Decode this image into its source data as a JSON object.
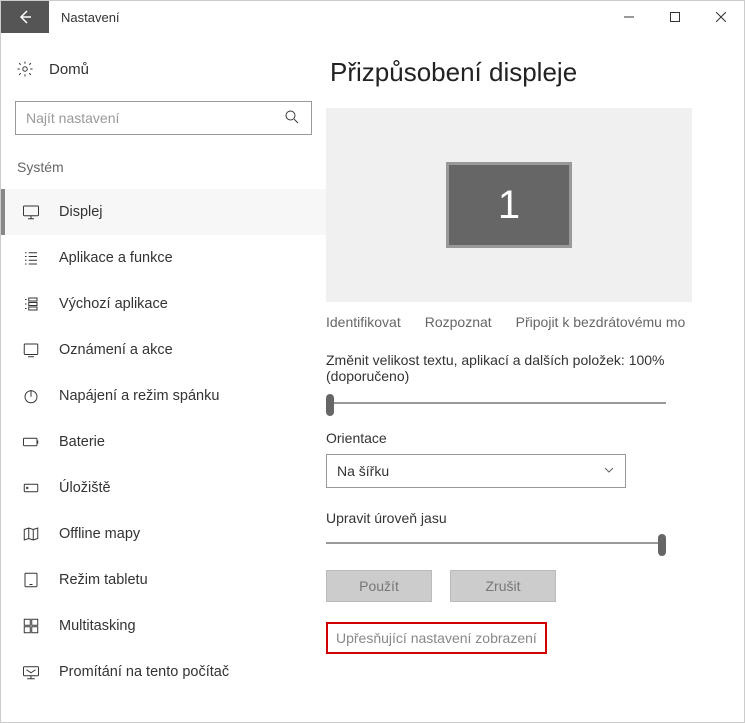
{
  "window": {
    "title": "Nastavení"
  },
  "home": {
    "label": "Domů"
  },
  "search": {
    "placeholder": "Najít nastavení"
  },
  "category": {
    "label": "Systém"
  },
  "nav": {
    "items": [
      {
        "label": "Displej"
      },
      {
        "label": "Aplikace a funkce"
      },
      {
        "label": "Výchozí aplikace"
      },
      {
        "label": "Oznámení a akce"
      },
      {
        "label": "Napájení a režim spánku"
      },
      {
        "label": "Baterie"
      },
      {
        "label": "Úložiště"
      },
      {
        "label": "Offline mapy"
      },
      {
        "label": "Režim tabletu"
      },
      {
        "label": "Multitasking"
      },
      {
        "label": "Promítání na tento počítač"
      }
    ]
  },
  "main": {
    "title": "Přizpůsobení displeje",
    "display_number": "1",
    "links": {
      "identify": "Identifikovat",
      "detect": "Rozpoznat",
      "wireless": "Připojit k bezdrátovému mo"
    },
    "scale_label": "Změnit velikost textu, aplikací a dalších položek: 100% (doporučeno)",
    "orientation_label": "Orientace",
    "orientation_value": "Na šířku",
    "brightness_label": "Upravit úroveň jasu",
    "apply": "Použít",
    "cancel": "Zrušit",
    "advanced": "Upřesňující nastavení zobrazení"
  }
}
